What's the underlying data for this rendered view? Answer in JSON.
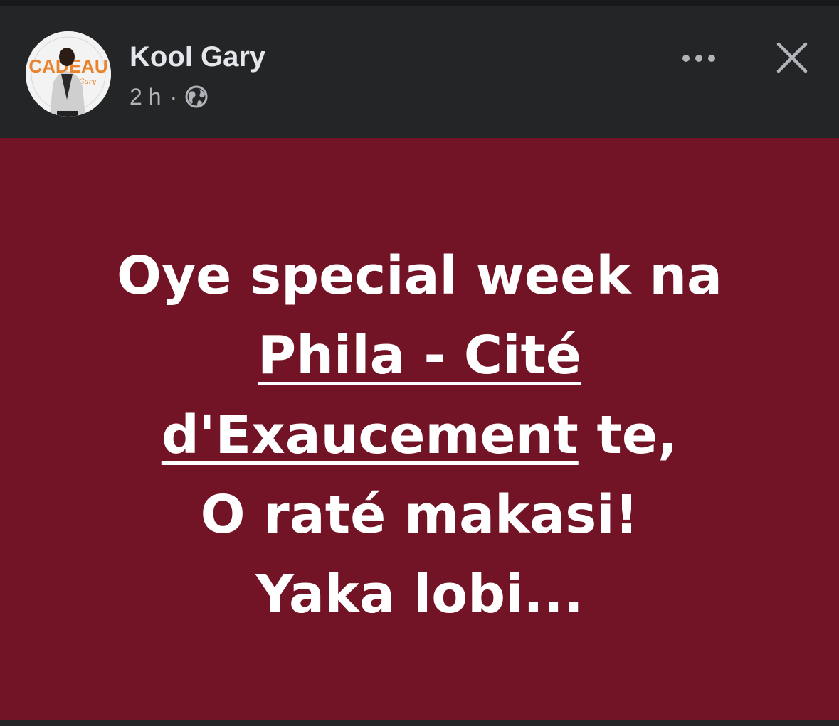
{
  "post": {
    "author": "Kool Gary",
    "time": "2 h",
    "separator": "·",
    "audience_icon": "globe-icon",
    "more_icon": "more-horizontal-icon",
    "close_icon": "close-icon",
    "avatar_logo_text": "CADEAU",
    "avatar_logo_script": "Kool Gary"
  },
  "message": {
    "line1": "Oye special week na",
    "line2": "Phila - Cité",
    "line3_underlined": "d'Exaucement",
    "line3_rest": " te,",
    "line4": "O raté makasi!",
    "line5": "Yaka lobi..."
  },
  "colors": {
    "background": "#242526",
    "card": "#731326",
    "text": "#ffffff",
    "name": "#e4e6eb",
    "meta": "#b0b3b8"
  }
}
